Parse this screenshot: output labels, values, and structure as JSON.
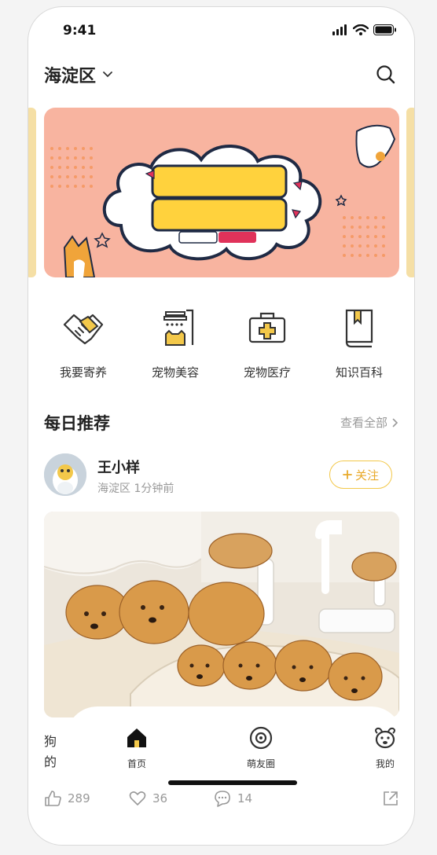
{
  "status": {
    "time": "9:41"
  },
  "header": {
    "location": "海淀区"
  },
  "categories": [
    {
      "label": "我要寄养",
      "icon": "handshake-icon"
    },
    {
      "label": "宠物美容",
      "icon": "shower-icon"
    },
    {
      "label": "宠物医疗",
      "icon": "medical-kit-icon"
    },
    {
      "label": "知识百科",
      "icon": "book-icon"
    }
  ],
  "section": {
    "title": "每日推荐",
    "see_all": "查看全部"
  },
  "post": {
    "username": "王小样",
    "meta": "海淀区  1分钟前",
    "follow": "关注",
    "caption_lines": [
      "狗",
      "的"
    ],
    "likes": "289",
    "favorites": "36",
    "comments": "14"
  },
  "tabbar": {
    "tabs": [
      {
        "label": "首页",
        "icon": "home-icon"
      },
      {
        "label": "萌友圈",
        "icon": "circle-icon"
      },
      {
        "label": "我的",
        "icon": "dog-face-icon"
      }
    ]
  },
  "colors": {
    "accent": "#f3c84a",
    "banner": "#f8b4a0",
    "banner_side": "#f5dfa5"
  }
}
